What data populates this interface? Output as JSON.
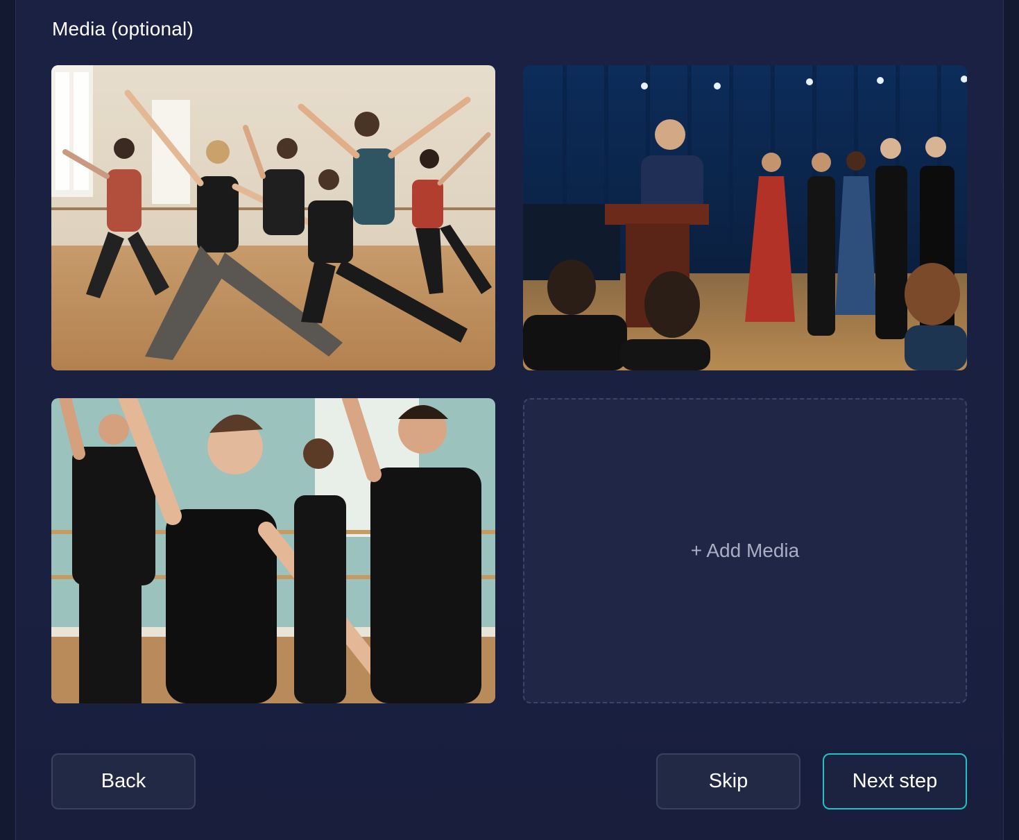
{
  "section": {
    "title": "Media (optional)"
  },
  "media": {
    "items": [
      {
        "icon": "photo-dance-class-lunge"
      },
      {
        "icon": "photo-award-ceremony"
      },
      {
        "icon": "photo-ballet-class"
      }
    ],
    "add_label": "+ Add Media"
  },
  "actions": {
    "back_label": "Back",
    "skip_label": "Skip",
    "next_label": "Next step"
  },
  "colors": {
    "background": "#1a2040",
    "accent": "#21c3c8",
    "button_bg": "#212945",
    "button_border": "#3a4262"
  }
}
